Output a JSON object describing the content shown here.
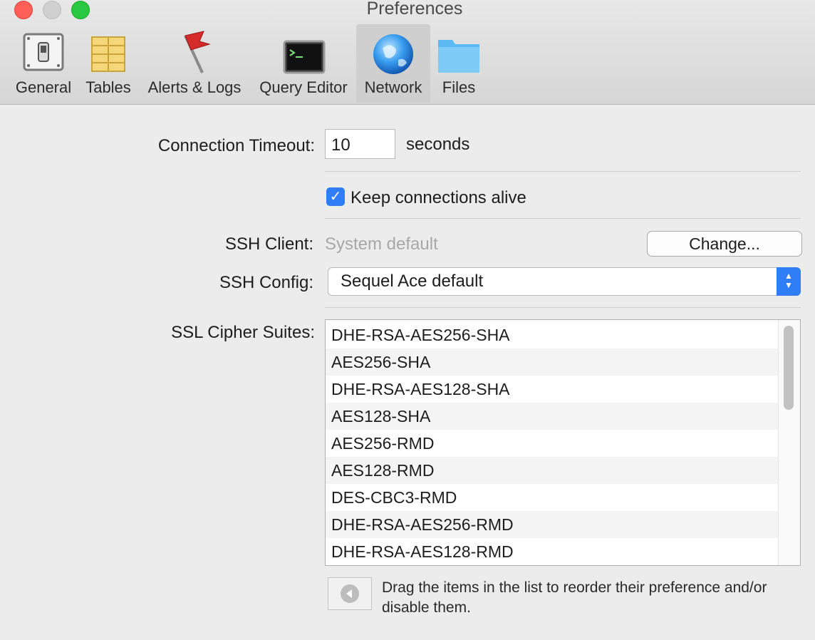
{
  "window": {
    "title": "Preferences"
  },
  "toolbar": {
    "tabs": [
      {
        "label": "General",
        "icon": "switch-icon"
      },
      {
        "label": "Tables",
        "icon": "table-grid-icon"
      },
      {
        "label": "Alerts & Logs",
        "icon": "red-flag-icon"
      },
      {
        "label": "Query Editor",
        "icon": "terminal-icon"
      },
      {
        "label": "Network",
        "icon": "globe-icon",
        "selected": true
      },
      {
        "label": "Files",
        "icon": "folder-icon"
      }
    ]
  },
  "network": {
    "timeout_label": "Connection Timeout:",
    "timeout_value": "10",
    "timeout_unit": "seconds",
    "keep_alive_label": "Keep connections alive",
    "keep_alive_checked": true,
    "ssh_client_label": "SSH Client:",
    "ssh_client_value": "System default",
    "change_button": "Change...",
    "ssh_config_label": "SSH Config:",
    "ssh_config_value": "Sequel Ace default",
    "ssl_label": "SSL Cipher Suites:",
    "ciphers": [
      "DHE-RSA-AES256-SHA",
      "AES256-SHA",
      "DHE-RSA-AES128-SHA",
      "AES128-SHA",
      "AES256-RMD",
      "AES128-RMD",
      "DES-CBC3-RMD",
      "DHE-RSA-AES256-RMD",
      "DHE-RSA-AES128-RMD"
    ],
    "help_text": "Drag the items in the list to reorder their preference and/or disable them."
  },
  "colors": {
    "accent": "#2f7ef7",
    "close": "#ff5f57",
    "maximize": "#28c840"
  }
}
